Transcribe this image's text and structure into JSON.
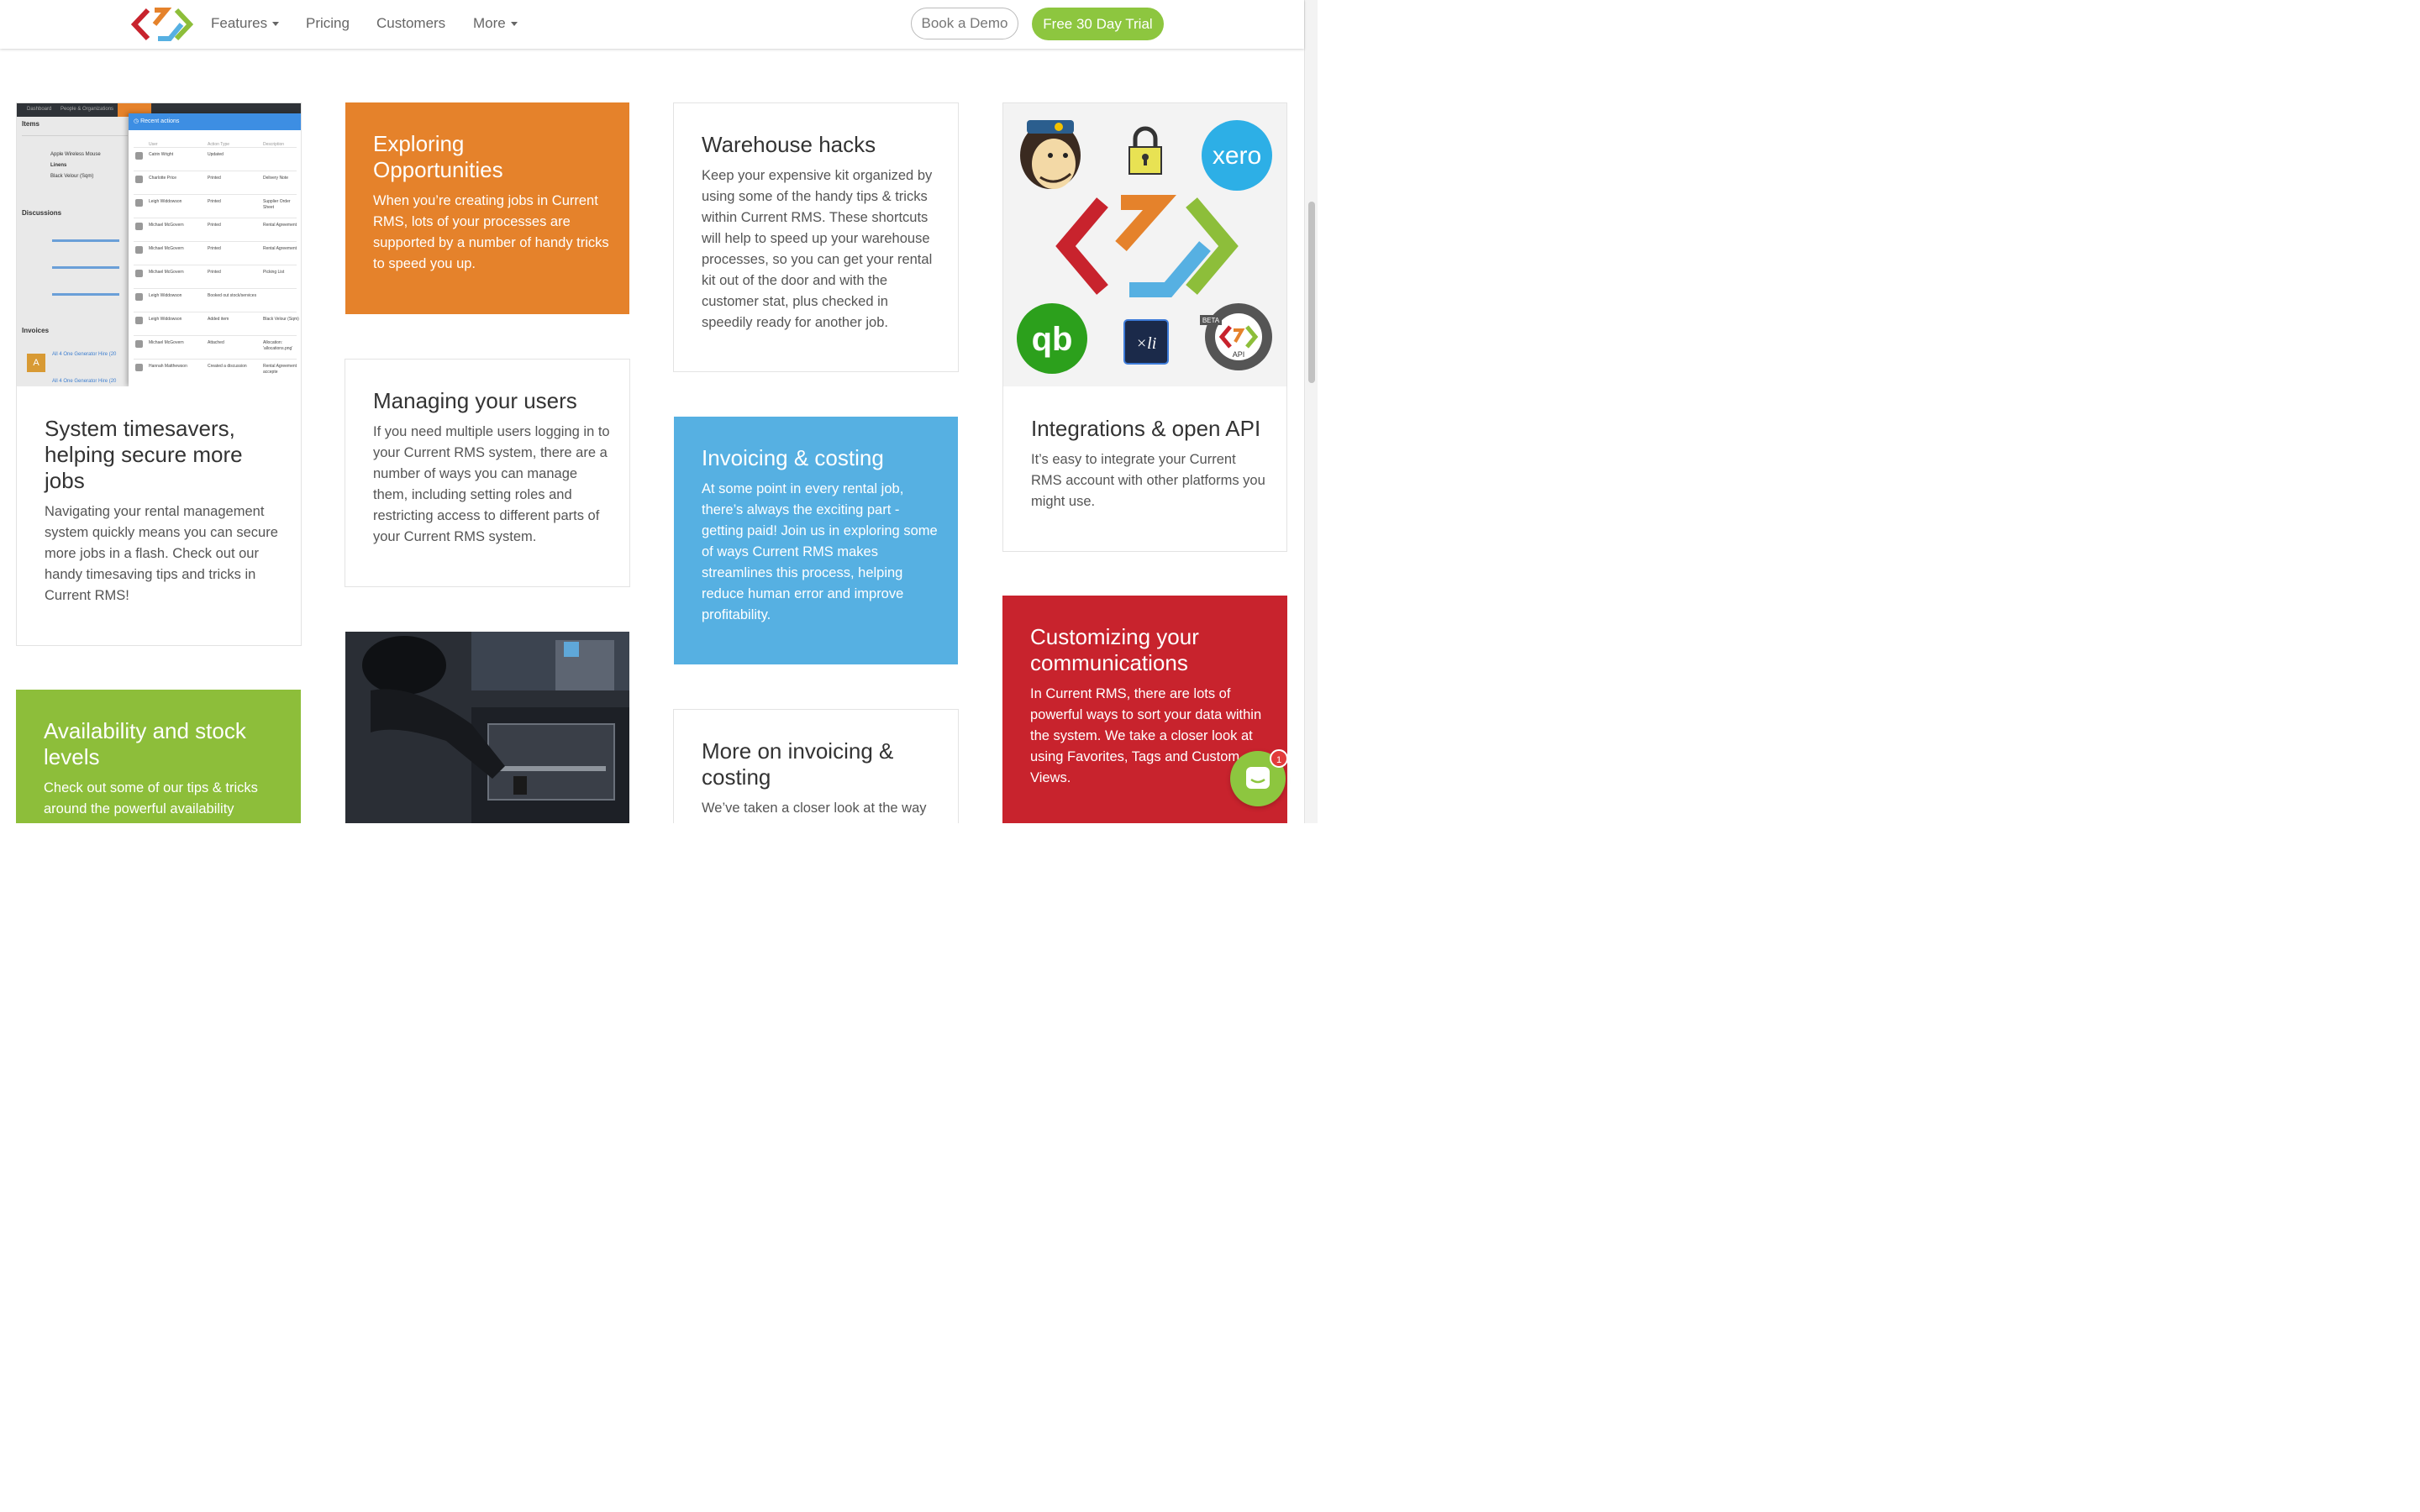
{
  "nav": {
    "features": "Features",
    "pricing": "Pricing",
    "customers": "Customers",
    "more": "More",
    "book_demo": "Book a Demo",
    "free_trial": "Free 30 Day Trial"
  },
  "cards": {
    "timesavers": {
      "title": "System timesavers, helping secure more jobs",
      "body": "Navigating your rental management system quickly means you can secure more jobs in a flash. Check out our handy timesaving tips and tricks in Current RMS!"
    },
    "availability": {
      "title": "Availability and stock levels",
      "body": "Check out some of our tips & tricks around the powerful availability"
    },
    "exploring": {
      "title": "Exploring Opportunities",
      "body": "When you’re creating jobs in Current RMS, lots of your processes are supported by a number of handy tricks to speed you up."
    },
    "users": {
      "title": "Managing your users",
      "body": "If you need multiple users logging in to your Current RMS system, there are a number of ways you can manage them, including setting roles and restricting access to different parts of your Current RMS system."
    },
    "warehouse": {
      "title": "Warehouse hacks",
      "body": "Keep your expensive kit organized by using some of the handy tips & tricks within Current RMS. These shortcuts will help to speed up your warehouse processes, so you can get your rental kit out of the door and with the customer stat, plus checked in speedily ready for another job."
    },
    "invoicing": {
      "title": "Invoicing & costing",
      "body": "At some point in every rental job, there’s always the exciting part - getting paid! Join us in exploring some of ways Current RMS makes streamlines this process, helping reduce human error and improve profitability."
    },
    "more_invoicing": {
      "title": "More on invoicing & costing",
      "body": "We’ve taken a closer look at the way"
    },
    "integrations": {
      "title": "Integrations & open API",
      "body": "It’s easy to integrate your Current RMS account with other platforms you might use."
    },
    "communications": {
      "title": "Customizing your communications",
      "body": "In Current RMS, there are lots of powerful ways to sort your data within the system. We take a closer look at using Favorites, Tags and Custom Views."
    }
  },
  "screenshot": {
    "tab_dashboard": "Dashboard",
    "tab_people": "People & Organizations",
    "section_items": "Items",
    "item_1": "Apple Wireless Mouse",
    "item_2": "Linens",
    "item_3": "Black Velour (Sqm)",
    "section_discussions": "Discussions",
    "section_invoices": "Invoices",
    "invoice_1": "All 4 One Generator Hire (20",
    "invoice_2": "All 4 One Generator Hire (20",
    "panel_title": "Recent actions",
    "col_user": "User",
    "col_action": "Action Type",
    "col_desc": "Description",
    "rows": [
      {
        "user": "Catrin Wright",
        "action": "Updated",
        "desc": ""
      },
      {
        "user": "Charlotte Price",
        "action": "Printed",
        "desc": "Delivery Note"
      },
      {
        "user": "Leigh Widdowson",
        "action": "Printed",
        "desc": "Supplier Order Sheet"
      },
      {
        "user": "Michael McGovern",
        "action": "Printed",
        "desc": "Rental Agreement"
      },
      {
        "user": "Michael McGovern",
        "action": "Printed",
        "desc": "Rental Agreement"
      },
      {
        "user": "Michael McGovern",
        "action": "Printed",
        "desc": "Picking List"
      },
      {
        "user": "Leigh Widdowson",
        "action": "Booked out stock/services",
        "desc": ""
      },
      {
        "user": "Leigh Widdowson",
        "action": "Added item",
        "desc": "Black Velour (Sqm)"
      },
      {
        "user": "Michael McGovern",
        "action": "Attached",
        "desc": "Allocation: 'allocations.png'"
      },
      {
        "user": "Hannah Matthewson",
        "action": "Created a discussion",
        "desc": "Rental Agreement accepte"
      }
    ],
    "avatar_letter": "A"
  },
  "integrations_logos": {
    "xero": "xero",
    "api": "API",
    "beta": "BETA",
    "xl": "×li"
  },
  "chat": {
    "badge": "1"
  },
  "colors": {
    "green": "#8dc63f",
    "orange": "#e5822b",
    "blue": "#56b0e2",
    "red": "#c8232d"
  }
}
